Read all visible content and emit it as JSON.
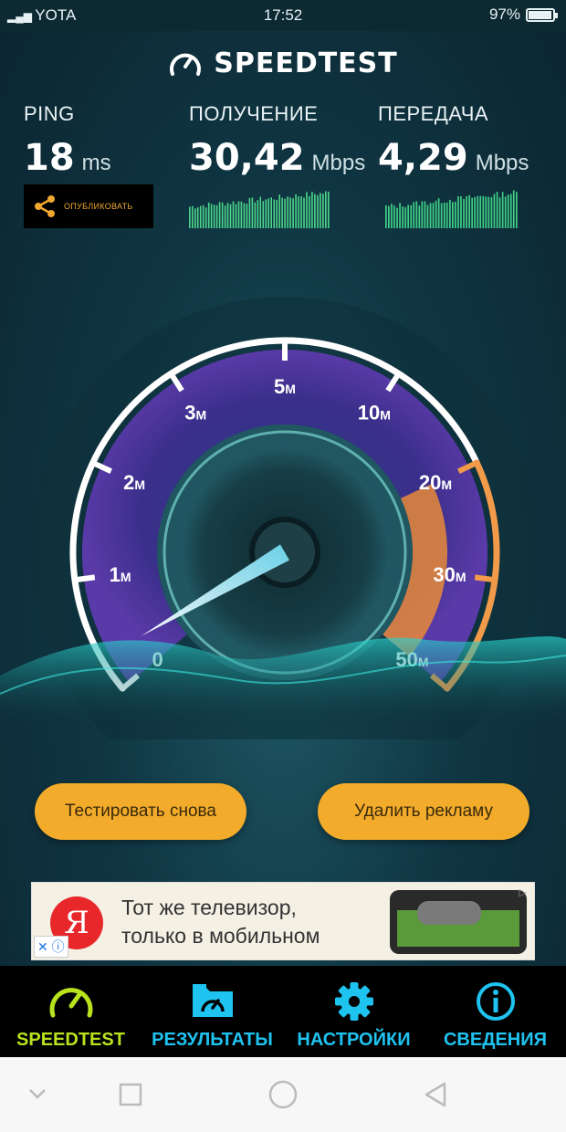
{
  "status_bar": {
    "carrier": "YOTA",
    "time": "17:52",
    "battery_percent": "97%",
    "battery_level": 0.97
  },
  "app": {
    "logo_text": "SPEEDTEST"
  },
  "metrics": {
    "ping": {
      "label": "PING",
      "value": "18",
      "unit": "ms"
    },
    "download": {
      "label": "ПОЛУЧЕНИЕ",
      "value": "30,42",
      "unit": "Mbps"
    },
    "upload": {
      "label": "ПЕРЕДАЧА",
      "value": "4,29",
      "unit": "Mbps"
    },
    "share_label": "ОПУБЛИКОВАТЬ"
  },
  "gauge": {
    "tick_labels": [
      {
        "v": "0",
        "s": ""
      },
      {
        "v": "1",
        "s": "M"
      },
      {
        "v": "2",
        "s": "M"
      },
      {
        "v": "3",
        "s": "M"
      },
      {
        "v": "5",
        "s": "M"
      },
      {
        "v": "10",
        "s": "M"
      },
      {
        "v": "20",
        "s": "M"
      },
      {
        "v": "30",
        "s": "M"
      },
      {
        "v": "50",
        "s": "M"
      }
    ],
    "needle_value_mbps": 0.3,
    "highlight_range_mbps": [
      20,
      50
    ]
  },
  "buttons": {
    "retest": "Тестировать снова",
    "remove_ads": "Удалить рекламу"
  },
  "ad": {
    "logo_letter": "Я",
    "line1": "Тот же телевизор,",
    "line2": "только в мобильном"
  },
  "tabs": [
    {
      "label": "SPEEDTEST",
      "icon": "speedometer-icon",
      "active": true
    },
    {
      "label": "РЕЗУЛЬТАТЫ",
      "icon": "results-folder-icon",
      "active": false
    },
    {
      "label": "НАСТРОЙКИ",
      "icon": "gear-icon",
      "active": false
    },
    {
      "label": "СВЕДЕНИЯ",
      "icon": "info-icon",
      "active": false
    }
  ],
  "colors": {
    "accent_cyan": "#1ec3f0",
    "active_green": "#b9e21e",
    "button_orange": "#f2ab2a",
    "gauge_orange": "#e8893a",
    "gauge_purple": "#7a5fd0"
  }
}
